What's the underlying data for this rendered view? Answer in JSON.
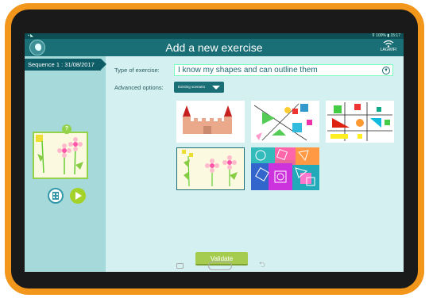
{
  "status_bar": {
    "left_icons": "▪ ◣",
    "right": "⊽ 100% ▮ 15:17"
  },
  "header": {
    "title": "Add a new exercise",
    "wifi_label": "LAGWIFI"
  },
  "sidebar": {
    "sequence_label": "Sequence 1 : 31/08/2017",
    "badge": "?"
  },
  "form": {
    "type_label": "Type of exercise:",
    "type_value": "I know my shapes and can outline them",
    "advanced_label": "Advanced options:",
    "advanced_button": "Existing scenario"
  },
  "exercise_cards": [
    {
      "name": "castle"
    },
    {
      "name": "shapes-lines"
    },
    {
      "name": "flag-shapes"
    },
    {
      "name": "flowers"
    },
    {
      "name": "shape-collage"
    }
  ],
  "validate_label": "Validate",
  "colors": {
    "orange": "#f2961c",
    "teal": "#1a6e76",
    "green": "#a5cc4f"
  }
}
